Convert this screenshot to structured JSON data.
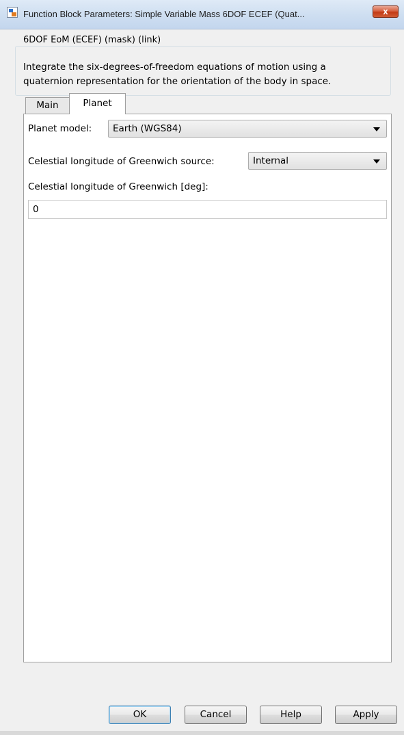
{
  "window": {
    "title": "Function Block Parameters: Simple Variable Mass 6DOF ECEF (Quat...",
    "close_label": "x",
    "app_icon": "simulink-block-icon"
  },
  "group": {
    "legend": "6DOF EoM (ECEF) (mask) (link)",
    "description_line1": "Integrate the six-degrees-of-freedom equations of motion using a",
    "description_line2": "quaternion representation for the orientation of the body in space."
  },
  "tabs": [
    {
      "label": "Main",
      "active": false
    },
    {
      "label": "Planet",
      "active": true
    }
  ],
  "planet_tab": {
    "planet_model_label": "Planet model:",
    "planet_model_value": "Earth (WGS84)",
    "greenwich_source_label": "Celestial longitude of Greenwich source:",
    "greenwich_source_value": "Internal",
    "greenwich_value_label": "Celestial longitude of Greenwich [deg]:",
    "greenwich_value": "0"
  },
  "buttons": {
    "ok": "OK",
    "cancel": "Cancel",
    "help": "Help",
    "apply": "Apply"
  }
}
